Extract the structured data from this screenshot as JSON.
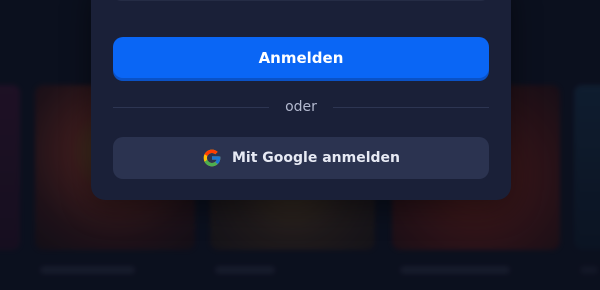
{
  "login": {
    "submit_label": "Anmelden",
    "divider_text": "oder",
    "google_label": "Mit Google anmelden"
  },
  "icons": {
    "google": "google-icon"
  },
  "colors": {
    "page_background": "#0f1424",
    "modal_background": "#1a2038",
    "primary_button": "#0a66f5",
    "secondary_button": "#2b3350",
    "divider_text": "#b3b9cf"
  }
}
